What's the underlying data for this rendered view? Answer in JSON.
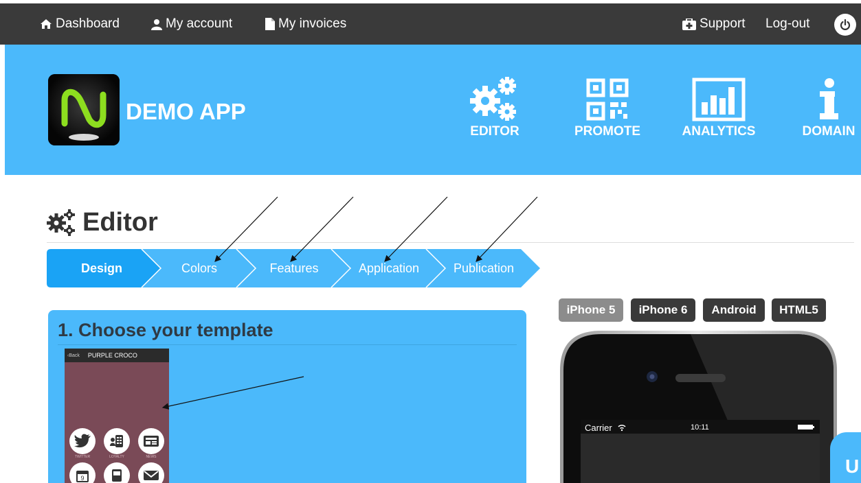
{
  "topbar": {
    "dashboard": "Dashboard",
    "account": "My account",
    "invoices": "My invoices",
    "support": "Support",
    "logout": "Log-out"
  },
  "header": {
    "app_name": "DEMO APP",
    "nav": [
      "EDITOR",
      "PROMOTE",
      "ANALYTICS",
      "DOMAIN"
    ]
  },
  "editor": {
    "title": "Editor",
    "steps": [
      "Design",
      "Colors",
      "Features",
      "Application",
      "Publication"
    ],
    "active_step": "Design"
  },
  "template_panel": {
    "title": "1. Choose your template",
    "thumb_back": "Back",
    "thumb_title": "PURPLE CROCO",
    "thumb_labels": [
      "TWITTER",
      "LOYALTY",
      "NEWS"
    ],
    "thumb_date": "9"
  },
  "devices": {
    "tabs": [
      "iPhone 5",
      "iPhone 6",
      "Android",
      "HTML5"
    ],
    "active": "iPhone 5"
  },
  "phone": {
    "carrier": "Carrier",
    "time": "10:11"
  },
  "chat": {
    "label": "U"
  },
  "colors": {
    "accent": "#4bb9fb",
    "topbar": "#3a3a3a",
    "step_active": "#1aa3f5",
    "step_inactive": "#4bb9fb",
    "tab_active": "#8c8c8c",
    "tab_inactive": "#3a3a3a"
  }
}
